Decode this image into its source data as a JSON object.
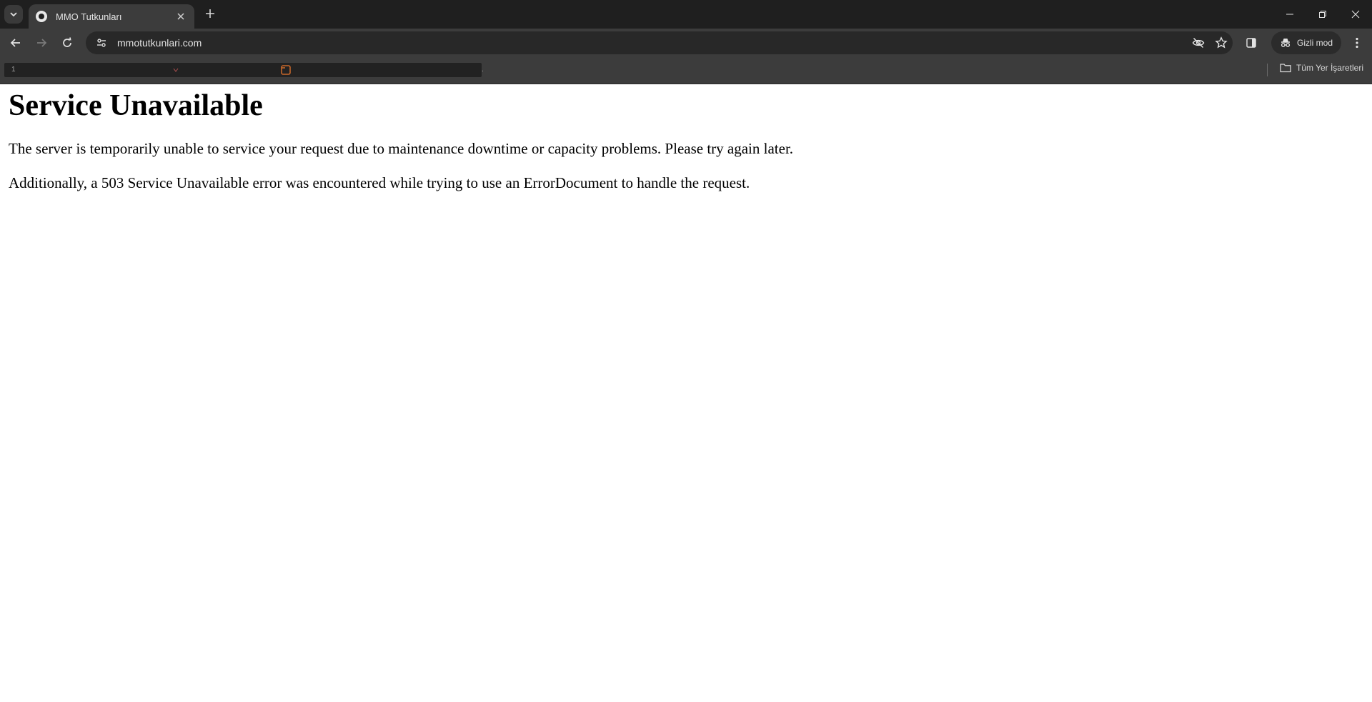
{
  "tabs": [
    {
      "title": "MMO Tutkunları"
    }
  ],
  "address_bar": {
    "url": "mmotutkunlari.com"
  },
  "toolbar": {
    "incognito_label": "Gizli mod"
  },
  "bookmarks_bar": {
    "first_marker": "1",
    "trailing_marker": ".",
    "all_bookmarks_label": "Tüm Yer İşaretleri"
  },
  "page": {
    "heading": "Service Unavailable",
    "paragraphs": [
      "The server is temporarily unable to service your request due to maintenance downtime or capacity problems. Please try again later.",
      "Additionally, a 503 Service Unavailable error was encountered while trying to use an ErrorDocument to handle the request."
    ]
  },
  "colors": {
    "tabstrip_bg": "#1f1f1f",
    "toolbar_bg": "#3c3c3c",
    "omnibox_bg": "#282828",
    "accent_orange": "#e8762c"
  }
}
